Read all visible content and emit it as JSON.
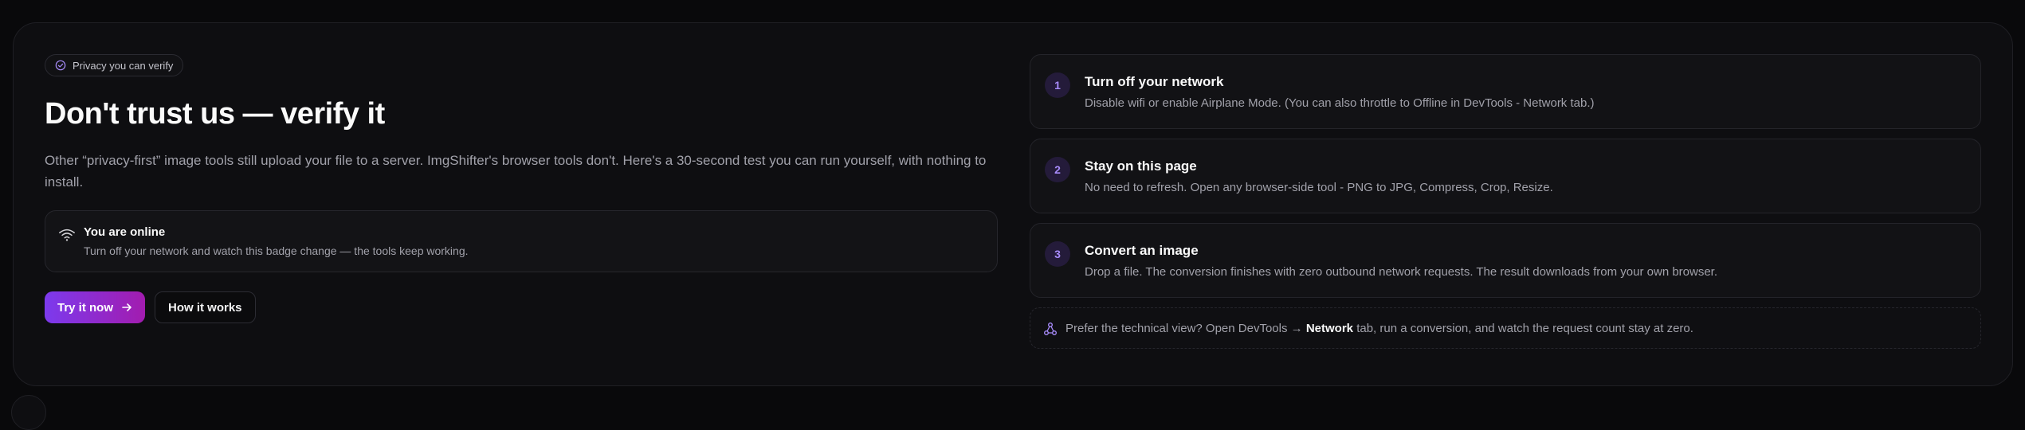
{
  "badge": {
    "label": "Privacy you can verify",
    "icon": "shield-check-icon"
  },
  "hero": {
    "title": "Don't trust us — verify it",
    "lede": "Other “privacy-first” image tools still upload your file to a server. ImgShifter's browser tools don't. Here's a 30-second test you can run yourself, with nothing to install."
  },
  "status": {
    "icon": "wifi-icon",
    "title": "You are online",
    "description": "Turn off your network and watch this badge change — the tools keep working."
  },
  "actions": {
    "primary_label": "Try it now",
    "secondary_label": "How it works"
  },
  "steps": [
    {
      "number": "1",
      "title": "Turn off your network",
      "description": "Disable wifi or enable Airplane Mode. (You can also throttle to Offline in DevTools - Network tab.)"
    },
    {
      "number": "2",
      "title": "Stay on this page",
      "description": "No need to refresh. Open any browser-side tool - PNG to JPG, Compress, Crop, Resize."
    },
    {
      "number": "3",
      "title": "Convert an image",
      "description": "Drop a file. The conversion finishes with zero outbound network requests. The result downloads from your own browser."
    }
  ],
  "note": {
    "icon": "network-icon",
    "prefix": "Prefer the technical view? Open DevTools →",
    "emphasis": "Network",
    "suffix": "tab, run a conversion, and watch the request count stay at zero."
  },
  "colors": {
    "accent_start": "#7c3aed",
    "accent_end": "#a21caf",
    "step_number": "#a78bfa",
    "background": "#09090b"
  }
}
